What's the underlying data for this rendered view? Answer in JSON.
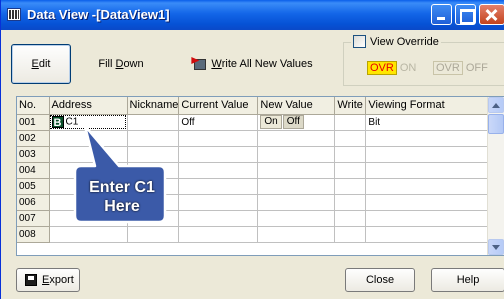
{
  "window": {
    "title": "Data View -[DataView1]"
  },
  "toolbar": {
    "edit_mnemonic": "E",
    "edit_rest": "dit",
    "fill_pre": "Fill ",
    "fill_mnemonic": "D",
    "fill_rest": "own",
    "write_mnemonic": "W",
    "write_rest": "rite All New Values"
  },
  "override": {
    "label": "View Override",
    "checked": false,
    "on_tag": "OVR",
    "on_word": "ON",
    "off_tag": "OVR",
    "off_word": "OFF"
  },
  "grid": {
    "columns": [
      "No.",
      "Address",
      "Nickname",
      "Current Value",
      "New Value",
      "Write",
      "Viewing Format"
    ],
    "rows": [
      {
        "no": "001",
        "address_icon": "B",
        "address": "C1",
        "nickname": "",
        "current": "Off",
        "new_on": "On",
        "new_off": "Off",
        "write": "",
        "format": "Bit"
      },
      {
        "no": "002",
        "address": "",
        "nickname": "",
        "current": "",
        "write": "",
        "format": ""
      },
      {
        "no": "003",
        "address": "",
        "nickname": "",
        "current": "",
        "write": "",
        "format": ""
      },
      {
        "no": "004",
        "address": "",
        "nickname": "",
        "current": "",
        "write": "",
        "format": ""
      },
      {
        "no": "005",
        "address": "",
        "nickname": "",
        "current": "",
        "write": "",
        "format": ""
      },
      {
        "no": "006",
        "address": "",
        "nickname": "",
        "current": "",
        "write": "",
        "format": ""
      },
      {
        "no": "007",
        "address": "",
        "nickname": "",
        "current": "",
        "write": "",
        "format": ""
      },
      {
        "no": "008",
        "address": "",
        "nickname": "",
        "current": "",
        "write": "",
        "format": ""
      }
    ]
  },
  "callout": {
    "line1": "Enter C1",
    "line2": "Here",
    "fill_color": "#3b5aa8",
    "border_color": "#ffffff"
  },
  "footer": {
    "export_mnemonic": "E",
    "export_rest": "xport",
    "close_label": "Close",
    "help_label": "Help"
  },
  "colors": {
    "titlebar": "#0a5fea",
    "ovr_on_bg": "#ffe600",
    "ovr_on_text": "#e80000"
  }
}
